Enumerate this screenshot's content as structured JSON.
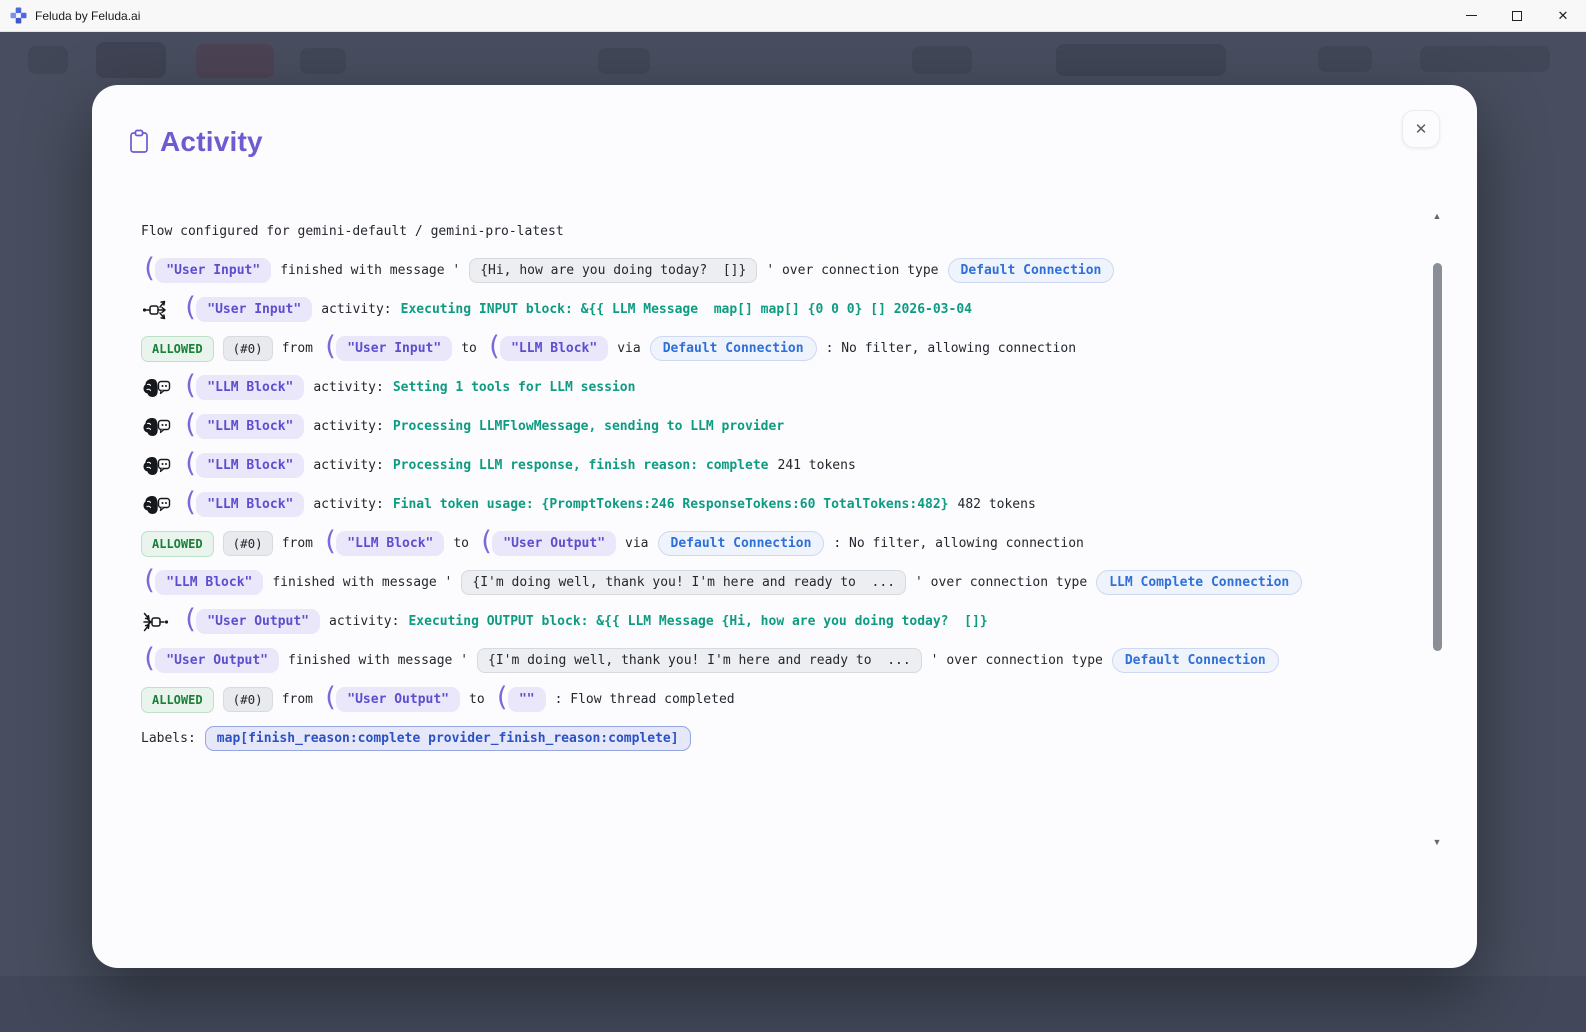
{
  "window": {
    "title": "Feluda by Feluda.ai"
  },
  "modal": {
    "title": "Activity"
  },
  "glyphs": {
    "paren": "(",
    "close": "✕",
    "scroll_up": "▲",
    "scroll_down": "▼"
  },
  "badges": {
    "user_input": "\"User Input\"",
    "llm_block": "\"LLM Block\"",
    "user_output": "\"User Output\"",
    "empty_string": "\"\""
  },
  "connections": {
    "default_connection": "Default Connection",
    "llm_complete_connection": "LLM Complete Connection"
  },
  "status": {
    "allowed": "ALLOWED",
    "thread_num": "(#0)"
  },
  "messages": {
    "hi_message": "{Hi, how are you doing today?  []}",
    "reply_message": "{I'm doing well, thank you! I'm here and ready to  ..."
  },
  "log": {
    "flow_configured": "Flow configured for gemini-default / gemini-pro-latest",
    "finished_with_message": "finished with message '",
    "over_connection_type": "' over connection type",
    "activity_prefix": "activity:",
    "from": "from",
    "to": "to",
    "via": "via",
    "no_filter": ": No filter, allowing connection",
    "flow_thread_completed": ": Flow thread completed",
    "labels_prefix": "Labels:",
    "labels_value": "map[finish_reason:complete provider_finish_reason:complete]",
    "exec_input": "Executing INPUT block: &{{ LLM Message  map[] map[] {0 0 0} [] 2026-03-04",
    "setting_tools": "Setting 1 tools for LLM session",
    "processing_flowmessage": "Processing LLMFlowMessage, sending to LLM provider",
    "processing_response": "Processing LLM response, finish reason: complete",
    "tokens_241": "241 tokens",
    "final_token_usage": "Final token usage: {PromptTokens:246 ResponseTokens:60 TotalTokens:482}",
    "tokens_482": "482 tokens",
    "exec_output": "Executing OUTPUT block: &{{ LLM Message {Hi, how are you doing today?  []}"
  },
  "colors": {
    "accent_purple": "#6c5ccf",
    "teal_activity": "#0d9c82",
    "blue_connection": "#2f6fd8",
    "green_allowed": "#1a7f37",
    "backdrop": "#484e5f"
  }
}
